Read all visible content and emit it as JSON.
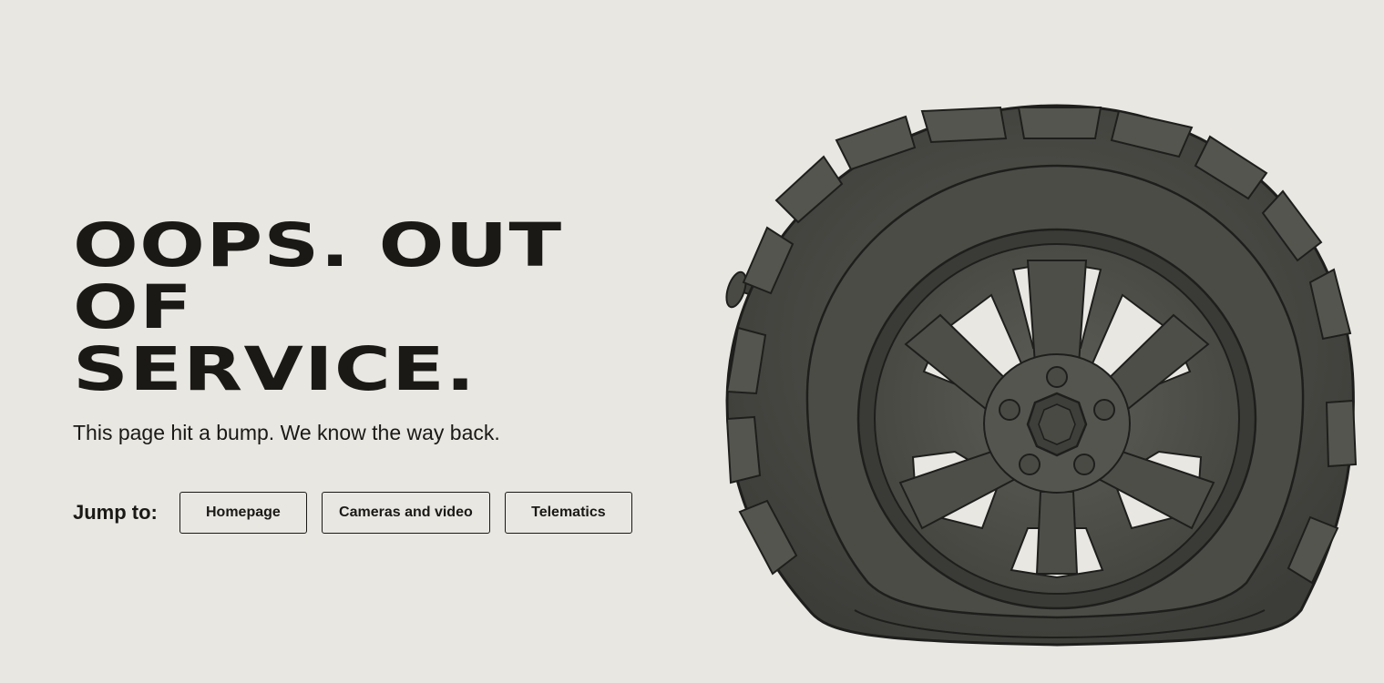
{
  "headline": {
    "line1": "OOPS. OUT OF",
    "line2": "SERVICE."
  },
  "subtext": "This page hit a bump. We know the way back.",
  "jump": {
    "label": "Jump to:",
    "links": [
      {
        "label": "Homepage"
      },
      {
        "label": "Cameras and video"
      },
      {
        "label": "Telematics"
      }
    ]
  },
  "colors": {
    "background": "#e8e7e2",
    "text": "#1b1916",
    "tire": "#4a4a45"
  },
  "illustration": "flat-tire-icon"
}
